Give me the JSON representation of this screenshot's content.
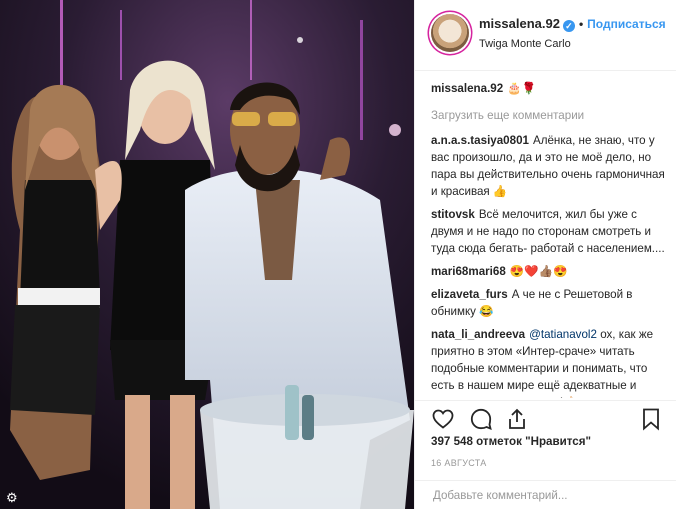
{
  "post": {
    "username": "missalena.92",
    "follow_label": "Подписаться",
    "separator": "•",
    "location": "Twiga Monte Carlo",
    "caption_user": "missalena.92",
    "caption_text": "🎂🌹",
    "load_more": "Загрузить еще комментарии",
    "likes": "397 548 отметок \"Нравится\"",
    "date": "16 АВГУСТА",
    "add_comment_placeholder": "Добавьте комментарий..."
  },
  "comments": [
    {
      "user": "a.n.a.s.tasiya0801",
      "text": "Алёнка, не знаю, что у вас произошло, да и это не моё дело, но пара вы действительно очень гармоничная и красивая 👍"
    },
    {
      "user": "stitovsk",
      "text": "Всё мелочится, жил бы уже с двумя и не надо по сторонам смотреть и туда сюда бегать- работай с населением...."
    },
    {
      "user": "mari68mari68",
      "text": "😍❤️👍🏽😍"
    },
    {
      "user": "elizaveta_furs",
      "text": "А че не с Решетовой в обнимку 😂"
    },
    {
      "user": "nata_li_andreeva",
      "mention": "@tatianavol2",
      "text": "ох, как же приятно в этом «Интер-сраче» читать подобные комментарии и понимать, что есть в нашем мире ещё адекватные и трезво-мыслящие люди!👍🏻"
    }
  ],
  "icons": {
    "verified": "✓",
    "photo_corner": "⚙"
  },
  "colors": {
    "link": "#3897f0",
    "muted": "#999999",
    "text": "#262626"
  }
}
